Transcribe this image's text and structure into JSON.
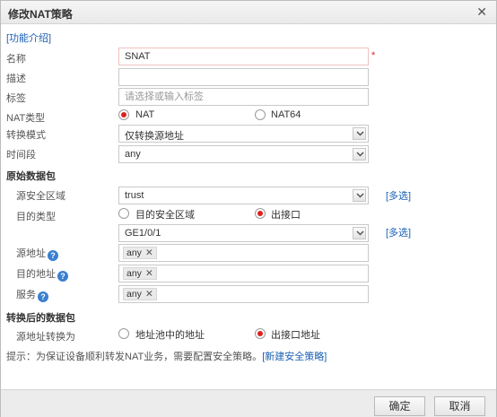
{
  "dialog": {
    "title": "修改NAT策略"
  },
  "help_link": "[功能介绍]",
  "fields": {
    "name": {
      "label": "名称",
      "value": "SNAT",
      "required_mark": "*"
    },
    "description": {
      "label": "描述",
      "value": ""
    },
    "tags": {
      "label": "标签",
      "placeholder": "请选择或输入标签"
    },
    "nat_type": {
      "label": "NAT类型",
      "options": [
        "NAT",
        "NAT64"
      ],
      "selected": "NAT"
    },
    "convert_mode": {
      "label": "转换模式",
      "value": "仅转换源地址"
    },
    "time_range": {
      "label": "时间段",
      "value": "any"
    }
  },
  "original_packet": {
    "section_title": "原始数据包",
    "src_zone": {
      "label": "源安全区域",
      "value": "trust",
      "multi_link": "[多选]"
    },
    "dest_type": {
      "label": "目的类型",
      "options": [
        "目的安全区域",
        "出接口"
      ],
      "selected": "出接口"
    },
    "interface": {
      "value": "GE1/0/1",
      "multi_link": "[多选]"
    },
    "src_addr": {
      "label": "源地址",
      "help": "?",
      "tags": [
        "any"
      ]
    },
    "dst_addr": {
      "label": "目的地址",
      "help": "?",
      "tags": [
        "any"
      ]
    },
    "service": {
      "label": "服务",
      "help": "?",
      "tags": [
        "any"
      ]
    }
  },
  "translated_packet": {
    "section_title": "转换后的数据包",
    "src_translate": {
      "label": "源地址转换为",
      "options": [
        "地址池中的地址",
        "出接口地址"
      ],
      "selected": "出接口地址"
    }
  },
  "hint": {
    "text": "提示：为保证设备顺利转发NAT业务，需要配置安全策略。",
    "link": "[新建安全策略]"
  },
  "buttons": {
    "ok": "确定",
    "cancel": "取消"
  }
}
